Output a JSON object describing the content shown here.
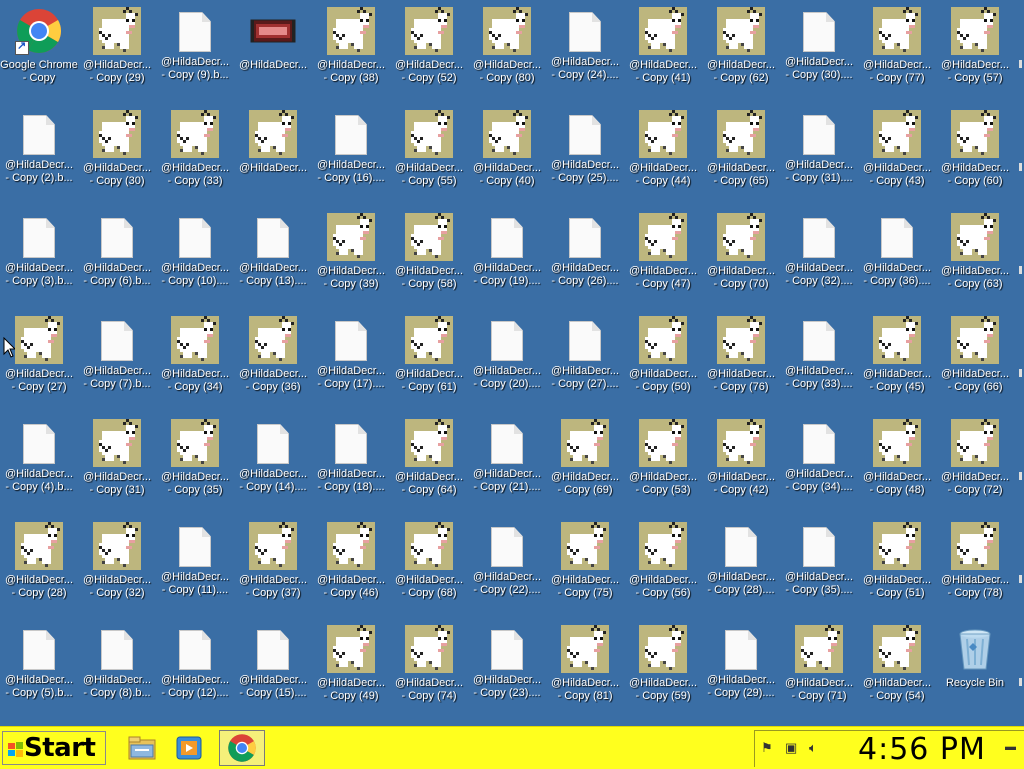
{
  "desktop": {
    "icons": [
      [
        "Google Chrome",
        "- Copy"
      ],
      [
        "@HildaDecr...",
        "- Copy (29)"
      ],
      [
        "@HildaDecr...",
        "- Copy (9).b..."
      ],
      [
        "@HildaDecr...",
        ""
      ],
      [
        "@HildaDecr...",
        "- Copy (38)"
      ],
      [
        "@HildaDecr...",
        "- Copy (52)"
      ],
      [
        "@HildaDecr...",
        "- Copy (80)"
      ],
      [
        "@HildaDecr...",
        "- Copy (24)...."
      ],
      [
        "@HildaDecr...",
        "- Copy (41)"
      ],
      [
        "@HildaDecr...",
        "- Copy (62)"
      ],
      [
        "@HildaDecr...",
        "- Copy (30)...."
      ],
      [
        "@HildaDecr...",
        "- Copy (77)"
      ],
      [
        "@HildaDecr...",
        "- Copy (57)"
      ],
      [
        "@HildaDecr...",
        "- Copy (2).b..."
      ],
      [
        "@HildaDecr...",
        "- Copy (30)"
      ],
      [
        "@HildaDecr...",
        "- Copy (33)"
      ],
      [
        "@HildaDecr...",
        ""
      ],
      [
        "@HildaDecr...",
        "- Copy (16)...."
      ],
      [
        "@HildaDecr...",
        "- Copy (55)"
      ],
      [
        "@HildaDecr...",
        "- Copy (40)"
      ],
      [
        "@HildaDecr...",
        "- Copy (25)...."
      ],
      [
        "@HildaDecr...",
        "- Copy (44)"
      ],
      [
        "@HildaDecr...",
        "- Copy (65)"
      ],
      [
        "@HildaDecr...",
        "- Copy (31)...."
      ],
      [
        "@HildaDecr...",
        "- Copy (43)"
      ],
      [
        "@HildaDecr...",
        "- Copy (60)"
      ],
      [
        "@HildaDecr...",
        "- Copy (3).b..."
      ],
      [
        "@HildaDecr...",
        "- Copy (6).b..."
      ],
      [
        "@HildaDecr...",
        "- Copy (10)...."
      ],
      [
        "@HildaDecr...",
        "- Copy (13)...."
      ],
      [
        "@HildaDecr...",
        "- Copy (39)"
      ],
      [
        "@HildaDecr...",
        "- Copy (58)"
      ],
      [
        "@HildaDecr...",
        "- Copy (19)...."
      ],
      [
        "@HildaDecr...",
        "- Copy (26)...."
      ],
      [
        "@HildaDecr...",
        "- Copy (47)"
      ],
      [
        "@HildaDecr...",
        "- Copy (70)"
      ],
      [
        "@HildaDecr...",
        "- Copy (32)...."
      ],
      [
        "@HildaDecr...",
        "- Copy (36)...."
      ],
      [
        "@HildaDecr...",
        "- Copy (63)"
      ],
      [
        "@HildaDecr...",
        "- Copy (27)"
      ],
      [
        "@HildaDecr...",
        "- Copy (7).b..."
      ],
      [
        "@HildaDecr...",
        "- Copy (34)"
      ],
      [
        "@HildaDecr...",
        "- Copy (36)"
      ],
      [
        "@HildaDecr...",
        "- Copy (17)...."
      ],
      [
        "@HildaDecr...",
        "- Copy (61)"
      ],
      [
        "@HildaDecr...",
        "- Copy (20)...."
      ],
      [
        "@HildaDecr...",
        "- Copy (27)...."
      ],
      [
        "@HildaDecr...",
        "- Copy (50)"
      ],
      [
        "@HildaDecr...",
        "- Copy (76)"
      ],
      [
        "@HildaDecr...",
        "- Copy (33)...."
      ],
      [
        "@HildaDecr...",
        "- Copy (45)"
      ],
      [
        "@HildaDecr...",
        "- Copy (66)"
      ],
      [
        "@HildaDecr...",
        "- Copy (4).b..."
      ],
      [
        "@HildaDecr...",
        "- Copy (31)"
      ],
      [
        "@HildaDecr...",
        "- Copy (35)"
      ],
      [
        "@HildaDecr...",
        "- Copy (14)...."
      ],
      [
        "@HildaDecr...",
        "- Copy (18)...."
      ],
      [
        "@HildaDecr...",
        "- Copy (64)"
      ],
      [
        "@HildaDecr...",
        "- Copy (21)...."
      ],
      [
        "@HildaDecr...",
        "- Copy (69)"
      ],
      [
        "@HildaDecr...",
        "- Copy (53)"
      ],
      [
        "@HildaDecr...",
        "- Copy (42)"
      ],
      [
        "@HildaDecr...",
        "- Copy (34)...."
      ],
      [
        "@HildaDecr...",
        "- Copy (48)"
      ],
      [
        "@HildaDecr...",
        "- Copy (72)"
      ],
      [
        "@HildaDecr...",
        "- Copy (28)"
      ],
      [
        "@HildaDecr...",
        "- Copy (32)"
      ],
      [
        "@HildaDecr...",
        "- Copy (11)...."
      ],
      [
        "@HildaDecr...",
        "- Copy (37)"
      ],
      [
        "@HildaDecr...",
        "- Copy (46)"
      ],
      [
        "@HildaDecr...",
        "- Copy (68)"
      ],
      [
        "@HildaDecr...",
        "- Copy (22)...."
      ],
      [
        "@HildaDecr...",
        "- Copy (75)"
      ],
      [
        "@HildaDecr...",
        "- Copy (56)"
      ],
      [
        "@HildaDecr...",
        "- Copy (28)...."
      ],
      [
        "@HildaDecr...",
        "- Copy (35)...."
      ],
      [
        "@HildaDecr...",
        "- Copy (51)"
      ],
      [
        "@HildaDecr...",
        "- Copy (78)"
      ],
      [
        "@HildaDecr...",
        "- Copy (5).b..."
      ],
      [
        "@HildaDecr...",
        "- Copy (8).b..."
      ],
      [
        "@HildaDecr...",
        "- Copy (12)...."
      ],
      [
        "@HildaDecr...",
        "- Copy (15)...."
      ],
      [
        "@HildaDecr...",
        "- Copy (49)"
      ],
      [
        "@HildaDecr...",
        "- Copy (74)"
      ],
      [
        "@HildaDecr...",
        "- Copy (23)...."
      ],
      [
        "@HildaDecr...",
        "- Copy (81)"
      ],
      [
        "@HildaDecr...",
        "- Copy (59)"
      ],
      [
        "@HildaDecr...",
        "- Copy (29)...."
      ],
      [
        "@HildaDecr...",
        "- Copy (71)"
      ],
      [
        "@HildaDecr...",
        "- Copy (54)"
      ],
      [
        "Recycle Bin",
        ""
      ]
    ],
    "icon_kinds": [
      "chrome",
      "image",
      "document",
      "video",
      "image",
      "image",
      "image",
      "document",
      "image",
      "image",
      "document",
      "image",
      "image",
      "document",
      "image",
      "image",
      "image",
      "document",
      "image",
      "image",
      "document",
      "image",
      "image",
      "document",
      "image",
      "image",
      "document",
      "document",
      "document",
      "document",
      "image",
      "image",
      "document",
      "document",
      "image",
      "image",
      "document",
      "document",
      "image",
      "image",
      "document",
      "image",
      "image",
      "document",
      "image",
      "document",
      "document",
      "image",
      "image",
      "document",
      "image",
      "image",
      "document",
      "image",
      "image",
      "document",
      "document",
      "image",
      "document",
      "image",
      "image",
      "image",
      "document",
      "image",
      "image",
      "image",
      "image",
      "document",
      "image",
      "image",
      "image",
      "document",
      "image",
      "image",
      "document",
      "document",
      "image",
      "image",
      "document",
      "document",
      "document",
      "document",
      "image",
      "image",
      "document",
      "image",
      "image",
      "document",
      "image",
      "image",
      "recycle-bin"
    ]
  },
  "taskbar": {
    "start_label": "Start",
    "pinned": [
      "file-explorer-icon",
      "media-player-icon",
      "chrome-icon"
    ],
    "clock": "4:56 PM",
    "tray": [
      "action-center-flag-icon",
      "network-icon",
      "speaker-icon",
      "show-desktop-icon"
    ]
  },
  "colors": {
    "desktop_background": "#3a6ea5",
    "taskbar_background": "#ffff1e",
    "thumbnail_background": "#bdb67e"
  }
}
